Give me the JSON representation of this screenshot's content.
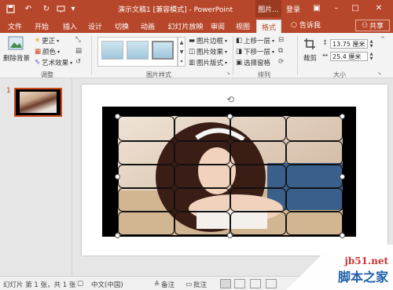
{
  "titlebar": {
    "title": "演示文稿1 [兼容模式] - PowerPoint",
    "context_tab": "图片...",
    "login": "登录",
    "quick_access": [
      "save-icon",
      "undo-icon",
      "redo-icon",
      "present-icon",
      "customize-icon"
    ]
  },
  "tabs": [
    "文件",
    "开始",
    "插入",
    "设计",
    "切换",
    "动画",
    "幻灯片放映",
    "审阅",
    "视图",
    "格式"
  ],
  "active_tab": "格式",
  "tell_me": "告诉我",
  "share": "共享",
  "ribbon": {
    "remove_bg": "删除背景",
    "adjust": {
      "corrections": "更正",
      "color": "颜色",
      "artistic": "艺术效果",
      "label": "调整"
    },
    "picture_styles": {
      "border": "图片边框",
      "effects": "图片效果",
      "layout": "图片版式",
      "label": "图片样式"
    },
    "arrange": {
      "bring_forward": "上移一层",
      "send_backward": "下移一层",
      "selection_pane": "选择窗格",
      "label": "排列"
    },
    "size": {
      "crop": "裁剪",
      "height": "13.75 厘米",
      "width": "25.4 厘米",
      "label": "大小"
    }
  },
  "thumbnail": {
    "number": "1"
  },
  "statusbar": {
    "slide_info": "幻灯片 第 1 张，共 1 张",
    "language": "中文(中国)",
    "notes": "备注",
    "comments": "批注"
  },
  "watermark": {
    "url": "jb51.net",
    "text": "脚本之家"
  },
  "colors": {
    "accent": "#b7472a",
    "selection": "#d04a1e"
  }
}
